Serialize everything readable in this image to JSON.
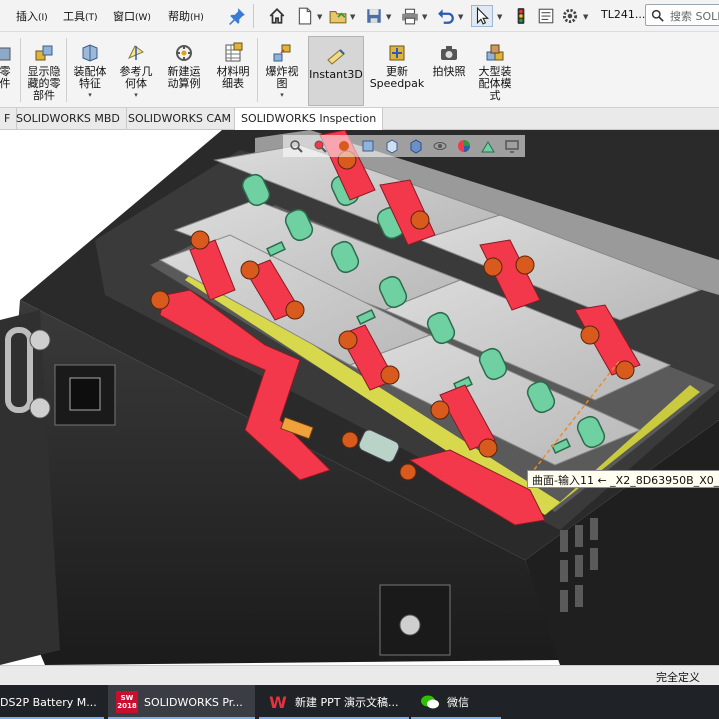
{
  "menu": {
    "items": [
      {
        "label": "插入",
        "accel": "(I)"
      },
      {
        "label": "工具",
        "accel": "(T)"
      },
      {
        "label": "窗口",
        "accel": "(W)"
      },
      {
        "label": "帮助",
        "accel": "(H)"
      }
    ],
    "pin_icon": "pin-icon",
    "document_title": "TL241...",
    "search_placeholder": "搜索 SOLI"
  },
  "quick_access": [
    "home-icon",
    "new-document-icon",
    "open-folder-icon",
    "save-icon",
    "print-icon",
    "undo-icon",
    "select-cursor-icon",
    "traffic-light-icon",
    "file-properties-icon",
    "options-gear-icon"
  ],
  "ribbon": {
    "buttons": [
      {
        "id": "partial-left",
        "label": "零\n件"
      },
      {
        "id": "show-hidden",
        "label": "显示隐\n藏的零\n部件"
      },
      {
        "id": "assembly-feature",
        "label": "装配体\n特征",
        "dropdown": "▾"
      },
      {
        "id": "reference-geometry",
        "label": "参考几\n何体",
        "dropdown": "▾"
      },
      {
        "id": "new-motion-study",
        "label": "新建运\n动算例"
      },
      {
        "id": "bom",
        "label": "材料明\n细表"
      },
      {
        "id": "exploded-view",
        "label": "爆炸视\n图",
        "dropdown": "▾"
      },
      {
        "id": "instant3d",
        "label": "Instant3D"
      },
      {
        "id": "update-speedpak",
        "label": "更新\nSpeedpak"
      },
      {
        "id": "snapshot",
        "label": "拍快照"
      },
      {
        "id": "large-assembly",
        "label": "大型装\n配体模\n式"
      }
    ]
  },
  "tabs": [
    "F",
    "SOLIDWORKS MBD",
    "SOLIDWORKS CAM",
    "SOLIDWORKS Inspection"
  ],
  "heads_up_icons": [
    "zoom-fit-icon",
    "zoom-area-icon",
    "previous-view-icon",
    "section-view-icon",
    "view-orientation-icon",
    "display-style-icon",
    "hide-show-items-icon",
    "edit-appearance-icon",
    "apply-scene-icon",
    "view-settings-icon"
  ],
  "tooltip": "曲面-输入11 ← _X2_8D63950B_X0_1",
  "status": {
    "right_text": "完全定义"
  },
  "taskbar": [
    {
      "label": "DS2P Battery M...",
      "icon": "battery-doc-icon"
    },
    {
      "label": "SOLIDWORKS Pr...",
      "icon": "solidworks-icon",
      "icon_text": "SW\n2018"
    },
    {
      "label": "新建 PPT 演示文稿...",
      "icon": "wps-icon",
      "icon_text": "W"
    },
    {
      "label": "微信",
      "icon": "wechat-icon"
    }
  ],
  "colors": {
    "busbar": "#f2384a",
    "terminal": "#d85a1c",
    "insulator_green": "#6fd0a2",
    "chassis": "#262626",
    "cell_gray": "#c9c9c9",
    "tray_yellow": "#d7d84c",
    "accent_blue": "#7cb0ea"
  }
}
